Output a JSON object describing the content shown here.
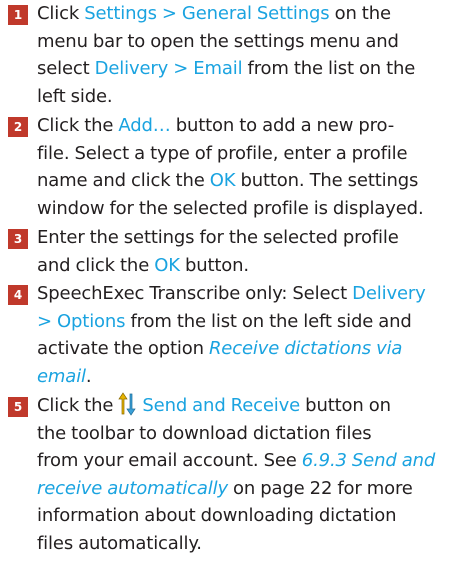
{
  "colors": {
    "text": "#231f20",
    "accent": "#1aa3e0",
    "step_badge": "#c0392b"
  },
  "steps": [
    {
      "number": "1",
      "lines": [
        [
          {
            "t": "Click "
          },
          {
            "t": "Settings > General Settings",
            "s": "hl"
          },
          {
            "t": " on the"
          }
        ],
        [
          {
            "t": "menu bar to open the settings menu and"
          }
        ],
        [
          {
            "t": "select "
          },
          {
            "t": "Delivery > Email",
            "s": "hl"
          },
          {
            "t": " from the list on the"
          }
        ],
        [
          {
            "t": "left side."
          }
        ]
      ]
    },
    {
      "number": "2",
      "lines": [
        [
          {
            "t": "Click the "
          },
          {
            "t": "Add…",
            "s": "hl"
          },
          {
            "t": " button to add a new pro-"
          }
        ],
        [
          {
            "t": "file. Select a type of profile, enter a profile"
          }
        ],
        [
          {
            "t": "name and click the "
          },
          {
            "t": "OK",
            "s": "hl"
          },
          {
            "t": " button. The settings"
          }
        ],
        [
          {
            "t": "window for the selected profile is displayed."
          }
        ]
      ]
    },
    {
      "number": "3",
      "lines": [
        [
          {
            "t": "Enter the settings for the selected profile"
          }
        ],
        [
          {
            "t": "and click the "
          },
          {
            "t": "OK",
            "s": "hl"
          },
          {
            "t": " button."
          }
        ]
      ]
    },
    {
      "number": "4",
      "lines": [
        [
          {
            "t": "SpeechExec Transcribe only: Select "
          },
          {
            "t": "Delivery",
            "s": "hl"
          }
        ],
        [
          {
            "t": "> Options",
            "s": "hl"
          },
          {
            "t": " from the list on the left side and"
          }
        ],
        [
          {
            "t": "activate the option "
          },
          {
            "t": "Receive dictations via",
            "s": "it"
          }
        ],
        [
          {
            "t": "email",
            "s": "it"
          },
          {
            "t": "."
          }
        ]
      ]
    },
    {
      "number": "5",
      "icon": "send-receive-icon",
      "lines": [
        [
          {
            "t": "Click the "
          },
          {
            "icon": true
          },
          {
            "t": "Send and Receive",
            "s": "hl"
          },
          {
            "t": " button on"
          }
        ],
        [
          {
            "t": "the toolbar to download dictation files"
          }
        ],
        [
          {
            "t": "from your email account. See "
          },
          {
            "t": "6.9.3 Send and",
            "s": "it"
          }
        ],
        [
          {
            "t": "receive automatically",
            "s": "it"
          },
          {
            "t": " on page 22 for more"
          }
        ],
        [
          {
            "t": "information about downloading dictation"
          }
        ],
        [
          {
            "t": "files automatically."
          }
        ]
      ]
    }
  ]
}
